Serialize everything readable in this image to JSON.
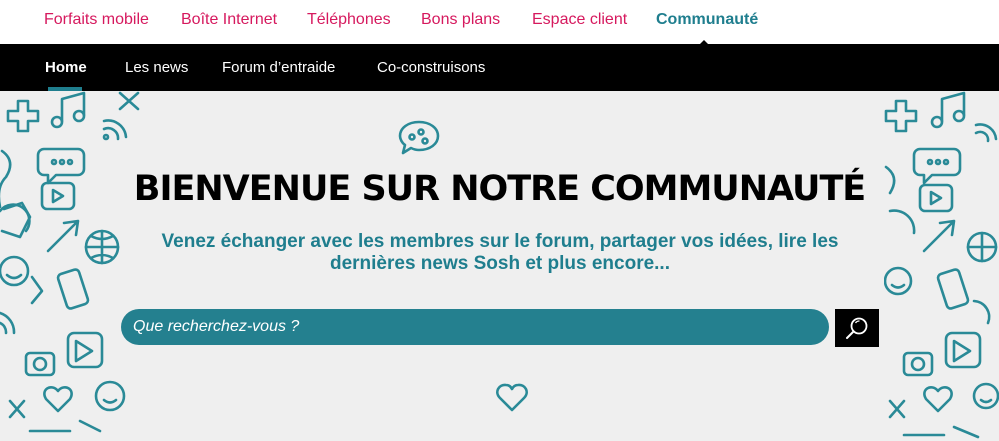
{
  "topnav": {
    "items": [
      {
        "label": "Forfaits mobile"
      },
      {
        "label": "Boîte Internet"
      },
      {
        "label": "Téléphones"
      },
      {
        "label": "Bons plans"
      },
      {
        "label": "Espace client"
      },
      {
        "label": "Communauté"
      }
    ],
    "active": "Communauté"
  },
  "subnav": {
    "items": [
      {
        "label": "Home"
      },
      {
        "label": "Les news"
      },
      {
        "label": "Forum d’entraide"
      },
      {
        "label": "Co-construisons"
      }
    ],
    "active": "Home"
  },
  "hero": {
    "title": "BIENVENUE SUR NOTRE COMMUNAUTÉ",
    "subtitle_line1": "Venez échanger avec les membres sur le forum, partager vos idées, lire les",
    "subtitle_line2": "dernières news Sosh et plus encore...",
    "search_placeholder": "Que recherchez-vous ?",
    "search_icon": "magnifier-icon",
    "decor_icons": [
      "chat-bubble-icon",
      "heart-icon"
    ]
  },
  "colors": {
    "pink": "#d6195e",
    "teal": "#1f7e8e",
    "search_bg": "#24808f",
    "hero_bg": "#efefef",
    "black": "#000000"
  }
}
